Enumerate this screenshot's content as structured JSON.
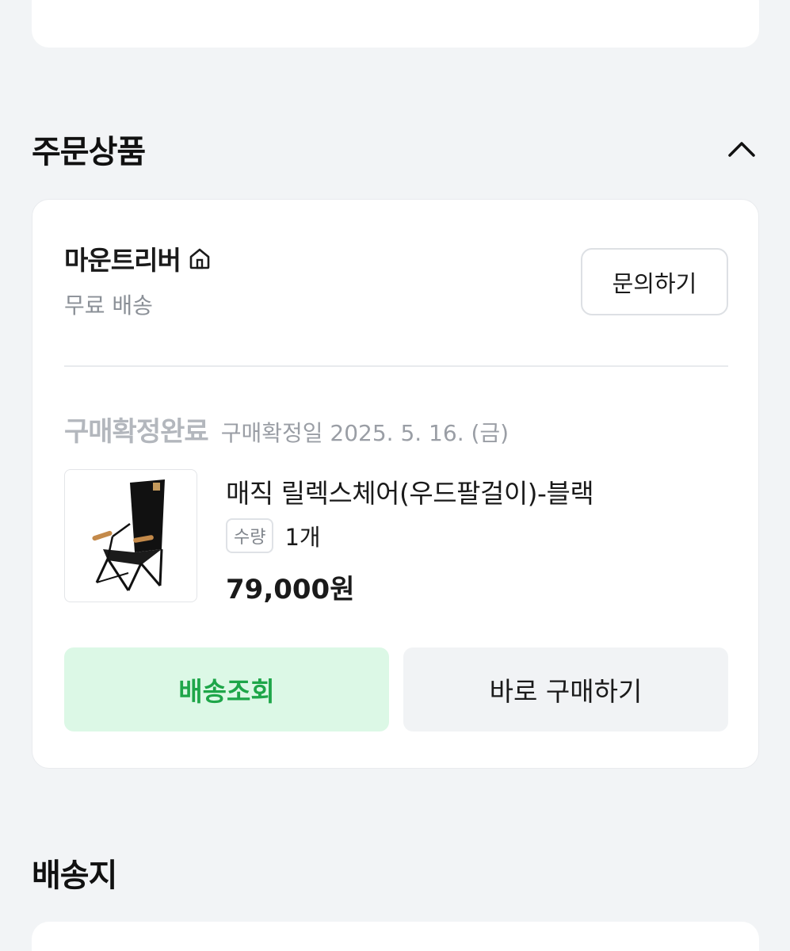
{
  "order_section": {
    "title": "주문상품",
    "seller": {
      "name": "마운트리버",
      "shipping": "무료 배송",
      "inquiry_label": "문의하기"
    },
    "status": {
      "label": "구매확정완료",
      "confirm_date": "구매확정일 2025. 5. 16. (금)"
    },
    "product": {
      "name": "매직 릴렉스체어(우드팔걸이)-블랙",
      "qty_label": "수량",
      "qty_value": "1개",
      "price": "79,000원"
    },
    "actions": {
      "track_label": "배송조회",
      "buy_label": "바로 구매하기"
    }
  },
  "shipping_section": {
    "title": "배송지"
  },
  "colors": {
    "accent_green": "#1ea649",
    "accent_green_bg": "#dcf8e6",
    "page_bg": "#f2f4f6"
  },
  "icons": {
    "collapse": "chevron-up-icon",
    "store": "home-icon"
  }
}
